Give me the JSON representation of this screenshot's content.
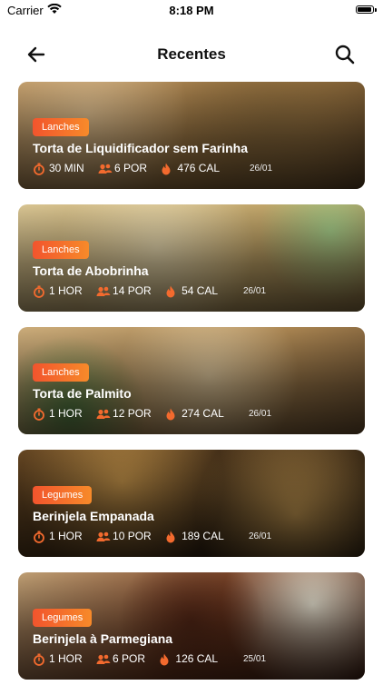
{
  "status": {
    "carrier": "Carrier",
    "time": "8:18 PM"
  },
  "nav": {
    "title": "Recentes"
  },
  "colors": {
    "accent_start": "#f2542d",
    "accent_end": "#f78a2a",
    "icon": "#f36a2e"
  },
  "recipes": [
    {
      "category": "Lanches",
      "title": "Torta de Liquidificador sem Farinha",
      "time": "30 MIN",
      "servings": "6 POR",
      "calories": "476 CAL",
      "date": "26/01"
    },
    {
      "category": "Lanches",
      "title": "Torta de Abobrinha",
      "time": "1 HOR",
      "servings": "14 POR",
      "calories": "54 CAL",
      "date": "26/01"
    },
    {
      "category": "Lanches",
      "title": "Torta de Palmito",
      "time": "1 HOR",
      "servings": "12 POR",
      "calories": "274 CAL",
      "date": "26/01"
    },
    {
      "category": "Legumes",
      "title": "Berinjela Empanada",
      "time": "1 HOR",
      "servings": "10 POR",
      "calories": "189 CAL",
      "date": "26/01"
    },
    {
      "category": "Legumes",
      "title": "Berinjela à Parmegiana",
      "time": "1 HOR",
      "servings": "6 POR",
      "calories": "126 CAL",
      "date": "25/01"
    }
  ]
}
